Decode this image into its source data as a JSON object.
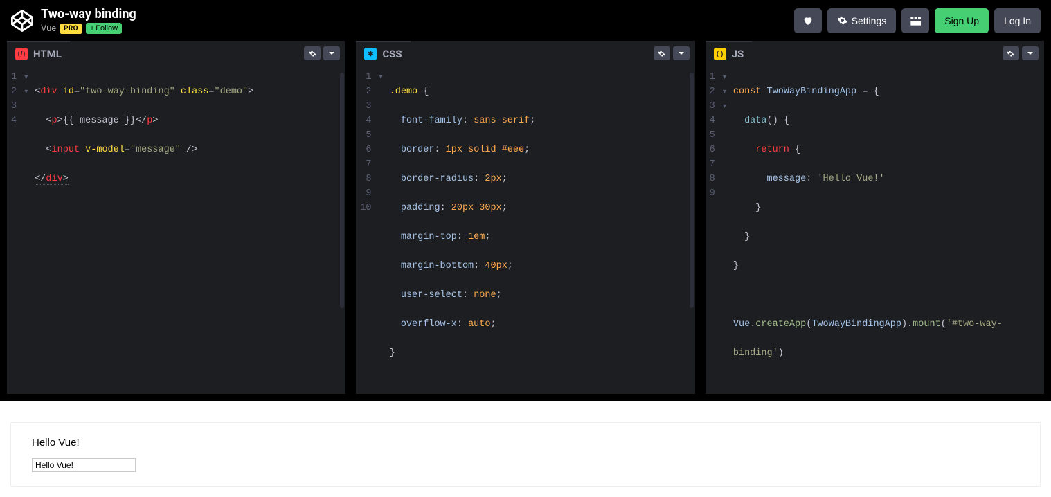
{
  "header": {
    "title": "Two-way binding",
    "author": "Vue",
    "pro_label": "PRO",
    "follow_label": "Follow",
    "settings_label": "Settings",
    "signup_label": "Sign Up",
    "login_label": "Log In"
  },
  "editors": {
    "html": {
      "label": "HTML",
      "lines": [
        "1",
        "2",
        "3",
        "4"
      ],
      "code_raw": "<div id=\"two-way-binding\" class=\"demo\">\n  <p>{{ message }}</p>\n  <input v-model=\"message\" />\n</div>"
    },
    "css": {
      "label": "CSS",
      "lines": [
        "1",
        "2",
        "3",
        "4",
        "5",
        "6",
        "7",
        "8",
        "9",
        "10"
      ],
      "code_raw": ".demo {\n  font-family: sans-serif;\n  border: 1px solid #eee;\n  border-radius: 2px;\n  padding: 20px 30px;\n  margin-top: 1em;\n  margin-bottom: 40px;\n  user-select: none;\n  overflow-x: auto;\n}"
    },
    "js": {
      "label": "JS",
      "lines": [
        "1",
        "2",
        "3",
        "4",
        "5",
        "6",
        "7",
        "8",
        "9"
      ],
      "code_raw": "const TwoWayBindingApp = {\n  data() {\n    return {\n      message: 'Hello Vue!'\n    }\n  }\n}\n\nVue.createApp(TwoWayBindingApp).mount('#two-way-binding')"
    }
  },
  "preview": {
    "message_text": "Hello Vue!",
    "input_value": "Hello Vue!"
  }
}
